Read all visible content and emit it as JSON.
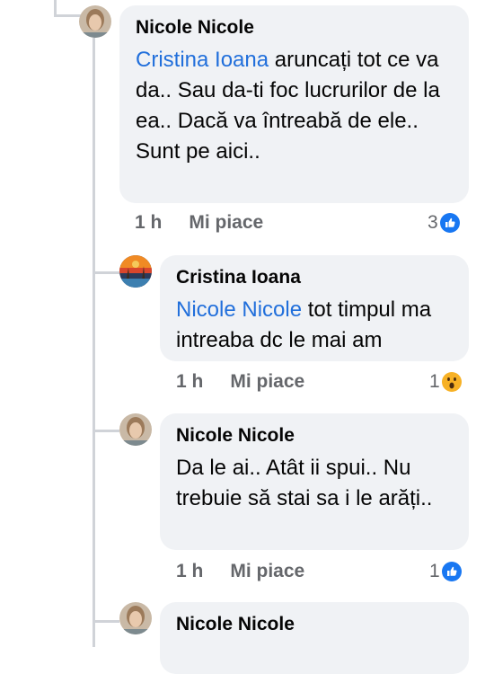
{
  "comments": [
    {
      "author": "Nicole Nicole",
      "mention": "Cristina Ioana",
      "text_after_mention": " aruncați tot ce va da.. Sau da-ti foc lucrurilor de la ea.. Dacă va întreabă de ele.. Sunt pe aici..",
      "time": "1 h",
      "like_label": "Mi piace",
      "reaction_count": "3",
      "reaction_icon": "like-icon"
    },
    {
      "author": "Cristina Ioana",
      "mention": "Nicole Nicole",
      "text_after_mention": " tot timpul ma intreaba dc le mai am",
      "time": "1 h",
      "like_label": "Mi piace",
      "reaction_count": "1",
      "reaction_icon": "wow-icon"
    },
    {
      "author": "Nicole Nicole",
      "mention": "",
      "text_after_mention": "Da le ai.. Atât ii spui.. Nu trebuie să stai sa i le arăți..",
      "time": "1 h",
      "like_label": "Mi piace",
      "reaction_count": "1",
      "reaction_icon": "like-icon"
    },
    {
      "author": "Nicole Nicole"
    }
  ],
  "colors": {
    "mention": "#216fdb",
    "bubble": "#f0f2f5",
    "meta": "#65676b",
    "like_blue": "#1877f2",
    "wow_yellow": "#f7b125"
  }
}
